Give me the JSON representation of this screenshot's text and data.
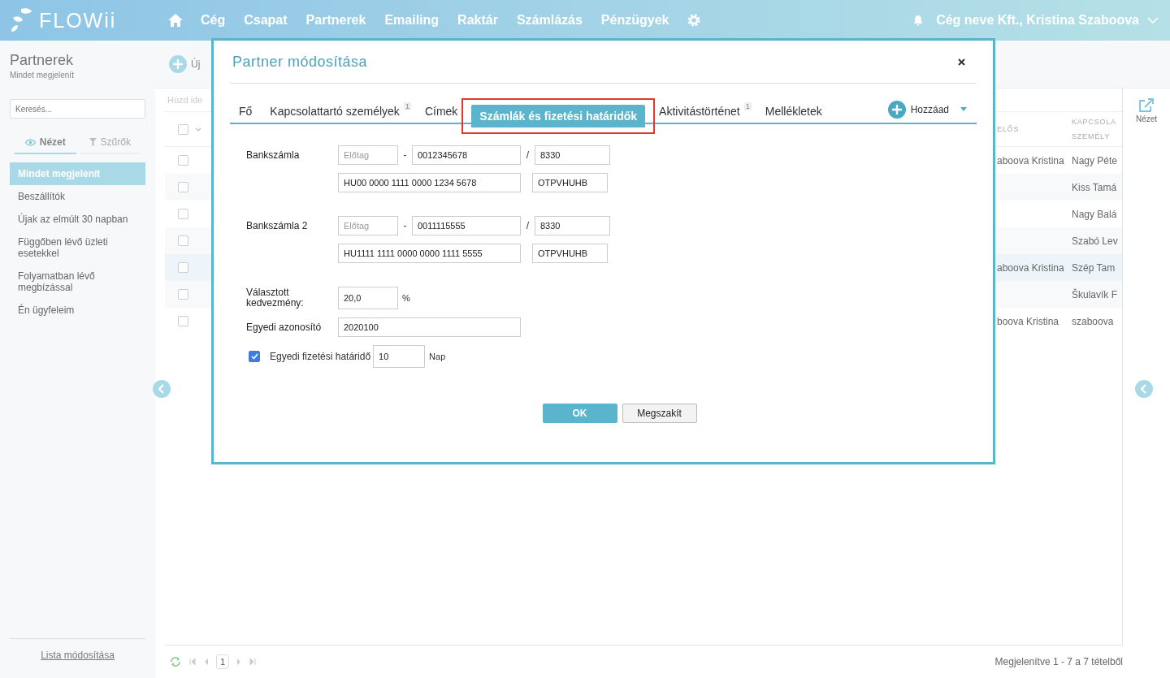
{
  "app": {
    "logo": "FLOWii"
  },
  "nav": {
    "items": [
      {
        "label": "Cég",
        "selected": false
      },
      {
        "label": "Csapat",
        "selected": false
      },
      {
        "label": "Partnerek",
        "selected": false
      },
      {
        "label": "Emailing",
        "selected": false
      },
      {
        "label": "Raktár",
        "selected": false
      },
      {
        "label": "Számlázás",
        "selected": false
      },
      {
        "label": "Pénzügyek",
        "selected": false
      }
    ],
    "user": "Cég neve Kft., Kristina Szaboova"
  },
  "sidebar": {
    "title": "Partnerek",
    "subtitle": "Mindet megjelenít",
    "search": {
      "placeholder": "Keresés..."
    },
    "tabs": [
      {
        "label": "Nézet",
        "kind": "view",
        "selected": true
      },
      {
        "label": "Szűrők",
        "kind": "filter",
        "selected": false
      }
    ],
    "items": [
      {
        "label": "Mindet megjelenít",
        "selected": true
      },
      {
        "label": "Beszállítók",
        "selected": false
      },
      {
        "label": "Újak az elmúlt 30 napban",
        "selected": false
      },
      {
        "label": "Függőben lévő üzleti esetekkel",
        "selected": false
      },
      {
        "label": "Folyamatban lévő megbízással",
        "selected": false
      },
      {
        "label": "Én ügyfeleim",
        "selected": false
      }
    ],
    "footer_link": "Lista módosítása"
  },
  "toolbar": {
    "new_button": "Új"
  },
  "table": {
    "group_hint": "Húzd ide",
    "select_all_checked": false,
    "columns": [
      "ELŐS",
      "KAPCSOLA SZEMÉLY"
    ],
    "rows": [
      {
        "checked": false,
        "cells": [
          "aboova Kristina",
          "Nagy Péte"
        ]
      },
      {
        "checked": false,
        "cells": [
          "",
          "Kiss Tamá"
        ]
      },
      {
        "checked": false,
        "cells": [
          "",
          "Nagy Balá"
        ]
      },
      {
        "checked": false,
        "cells": [
          "",
          "Szabó Lev"
        ]
      },
      {
        "checked": false,
        "cells": [
          "aboova Kristina",
          "Szép Tam"
        ]
      },
      {
        "checked": false,
        "cells": [
          "",
          "Škulavík F"
        ]
      },
      {
        "checked": false,
        "cells": [
          "boova Kristina",
          "szaboova"
        ]
      }
    ],
    "pager": {
      "page": "1",
      "summary": "Megjelenítve 1 - 7 a 7 tételből"
    }
  },
  "right_rail": {
    "view_label": "Nézet"
  },
  "modal": {
    "title": "Partner módosítása",
    "tabs": [
      {
        "label": "Fő",
        "selected": false,
        "highlighted": false
      },
      {
        "label": "Kapcsolattartó személyek",
        "badge": "1",
        "selected": false,
        "highlighted": false
      },
      {
        "label": "Címek",
        "selected": false,
        "highlighted": false
      },
      {
        "label": "Számlák és fizetési határidők",
        "selected": true,
        "highlighted": true
      },
      {
        "label": "Aktivitástörténet",
        "badge": "1",
        "selected": false,
        "highlighted": false
      },
      {
        "label": "Mellékletek",
        "selected": false,
        "highlighted": false
      }
    ],
    "add_button": "Hozzáad",
    "bank_accounts": [
      {
        "label": "Bankszámla",
        "prefix_placeholder": "Előtag",
        "dash": "-",
        "number": "0012345678",
        "slash": "/",
        "bank_code": "8330",
        "iban": "HU00 0000 1111 0000 1234 5678",
        "bic": "OTPVHUHB"
      },
      {
        "label": "Bankszámla 2",
        "prefix_placeholder": "Előtag",
        "dash": "-",
        "number": "0011115555",
        "slash": "/",
        "bank_code": "8330",
        "iban": "HU1111 1111 0000 0000 1111 5555",
        "bic": "OTPVHUHB"
      }
    ],
    "discount": {
      "label": "Választott kedvezmény:",
      "value": "20,0",
      "unit": "%"
    },
    "custom_id": {
      "label": "Egyedi azonosító",
      "value": "2020100"
    },
    "due": {
      "checked": true,
      "label": "Egyedi fizetési határidő",
      "value": "10",
      "unit": "Nap"
    },
    "buttons": [
      {
        "label": "OK",
        "kind": "primary"
      },
      {
        "label": "Megszakít",
        "kind": "secondary"
      }
    ]
  }
}
